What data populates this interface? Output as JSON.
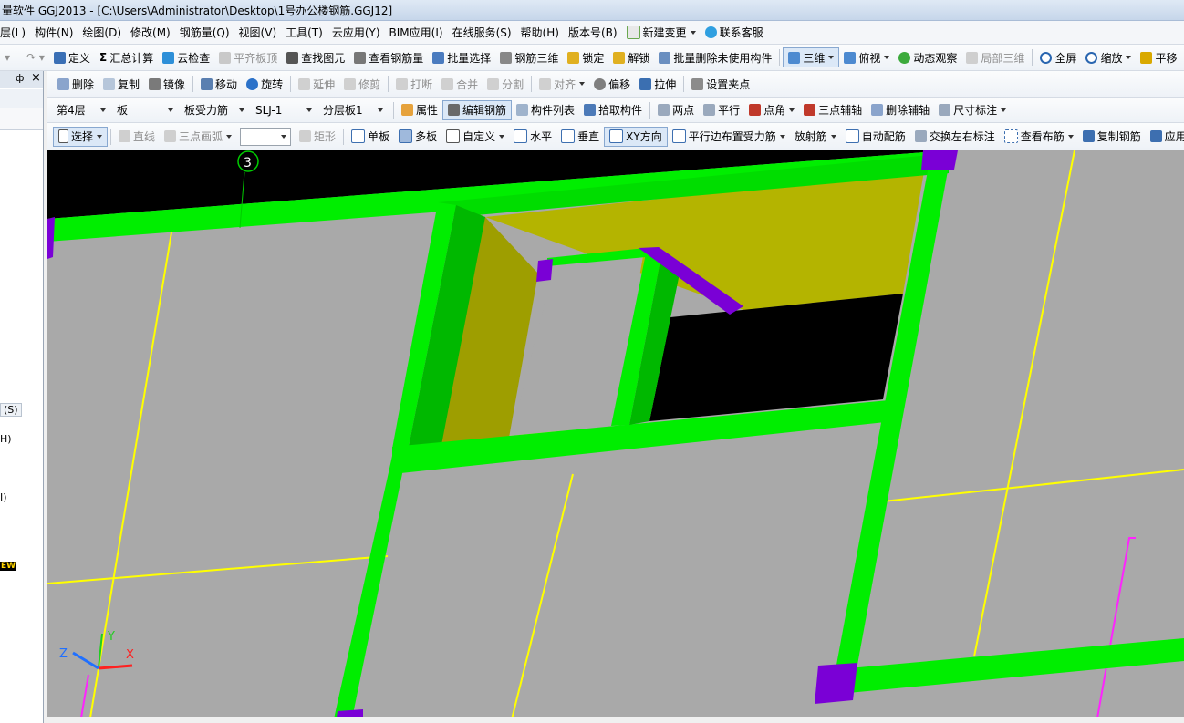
{
  "window": {
    "title": "量软件 GGJ2013 - [C:\\Users\\Administrator\\Desktop\\1号办公楼钢筋.GGJ12]"
  },
  "menu": [
    "层(L)",
    "构件(N)",
    "绘图(D)",
    "修改(M)",
    "钢筋量(Q)",
    "视图(V)",
    "工具(T)",
    "云应用(Y)",
    "BIM应用(I)",
    "在线服务(S)",
    "帮助(H)",
    "版本号(B)",
    "新建变更",
    "联系客服"
  ],
  "toolbar1": [
    "定义",
    "汇总计算",
    "云检查",
    "平齐板顶",
    "查找图元",
    "查看钢筋量",
    "批量选择",
    "钢筋三维",
    "锁定",
    "解锁",
    "批量删除未使用构件",
    "三维",
    "俯视",
    "动态观察",
    "局部三维",
    "全屏",
    "缩放",
    "平移"
  ],
  "toolbar2": [
    "删除",
    "复制",
    "镜像",
    "移动",
    "旋转",
    "延伸",
    "修剪",
    "打断",
    "合并",
    "分割",
    "对齐",
    "偏移",
    "拉伸",
    "设置夹点"
  ],
  "toolbar3": {
    "floor": "第4层",
    "type": "板",
    "subtype": "板受力筋",
    "name": "SLJ-1",
    "layer": "分层板1",
    "buttons": [
      "属性",
      "编辑钢筋",
      "构件列表",
      "拾取构件",
      "两点",
      "平行",
      "点角",
      "三点辅轴",
      "删除辅轴",
      "尺寸标注"
    ]
  },
  "toolbar4": {
    "select": "选择",
    "draw": [
      "直线",
      "三点画弧"
    ],
    "combo_value": "",
    "buttons": [
      "矩形",
      "单板",
      "多板",
      "自定义",
      "水平",
      "垂直",
      "XY方向",
      "平行边布置受力筋",
      "放射筋",
      "自动配筋",
      "交换左右标注",
      "查看布筋",
      "复制钢筋",
      "应用"
    ]
  },
  "left_panel": {
    "pin": "ф",
    "close": "×",
    "fragments": [
      "(S)",
      "H)",
      "I)",
      "EW"
    ]
  },
  "viewport": {
    "axis_number": "3",
    "axes": {
      "x": "X",
      "y": "Y",
      "z": "Z"
    },
    "colors": {
      "background": "#a9a9a9",
      "beam": "#00ee00",
      "beam_shade": "#00b800",
      "column": "#7a00d6",
      "slab": "#b8b800",
      "axis_line": "#ffff00",
      "void": "#000000"
    }
  }
}
